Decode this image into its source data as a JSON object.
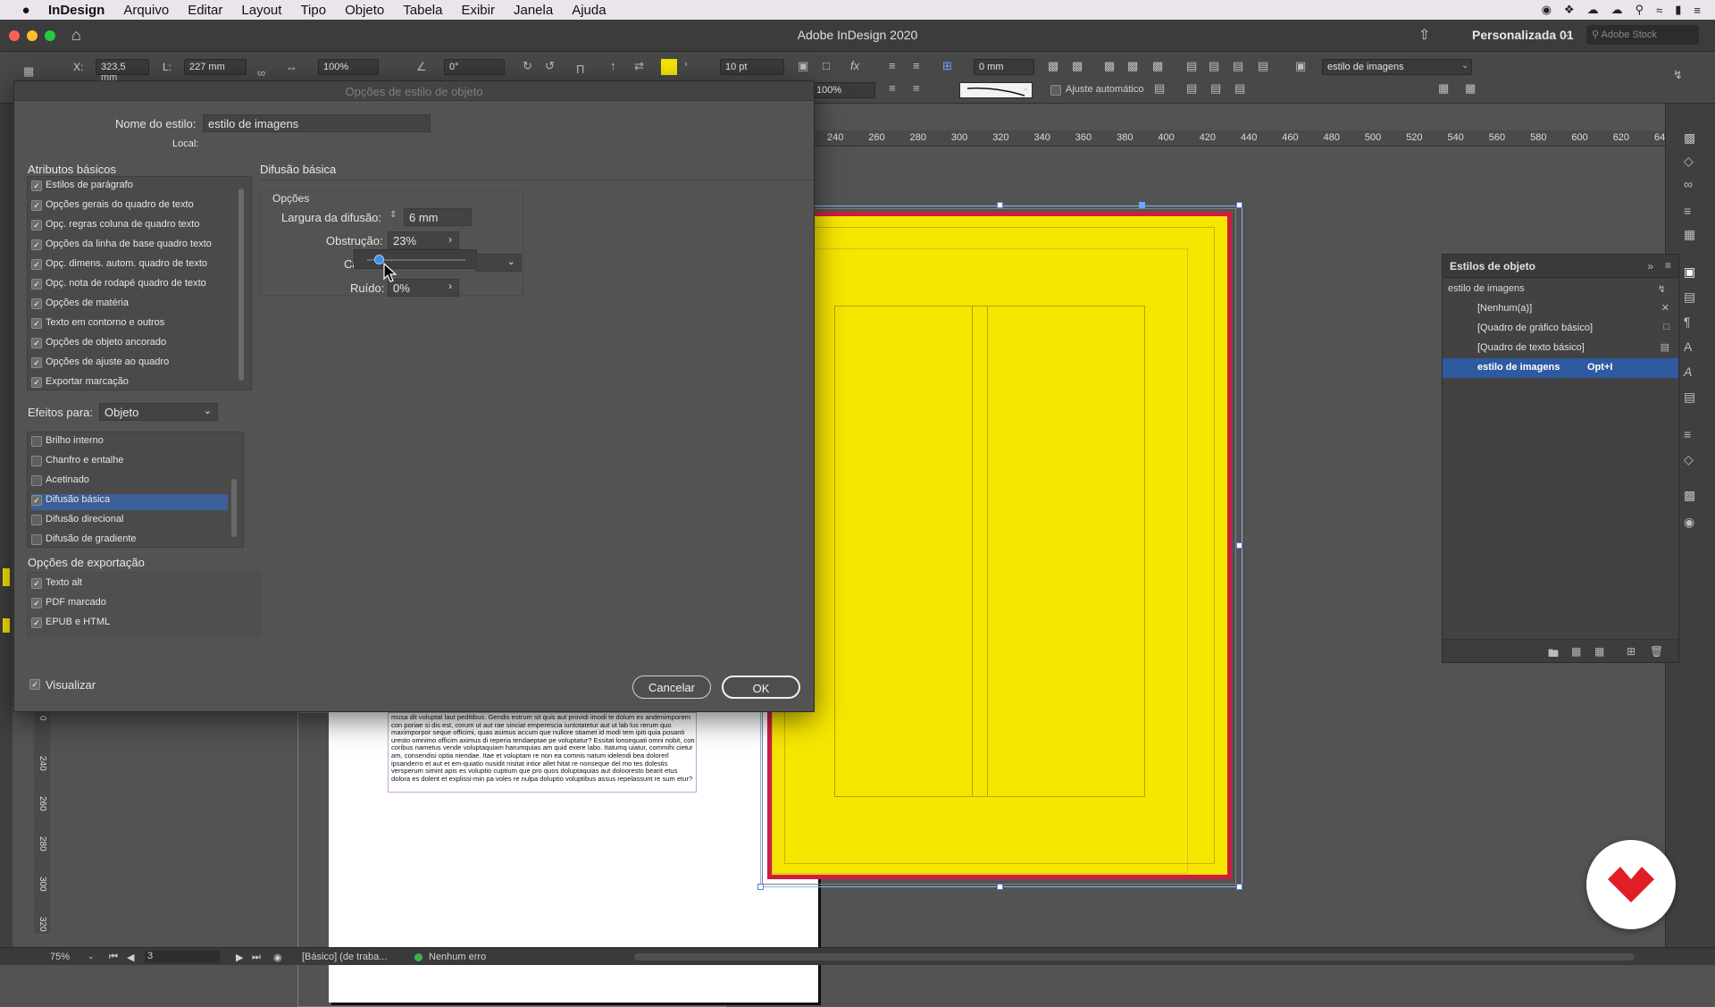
{
  "menubar": {
    "apple": "",
    "app": "InDesign",
    "items": [
      "Arquivo",
      "Editar",
      "Layout",
      "Tipo",
      "Objeto",
      "Tabela",
      "Exibir",
      "Janela",
      "Ajuda"
    ]
  },
  "window": {
    "title": "Adobe InDesign 2020",
    "workspace": "Personalizada 01",
    "stock_placeholder": "Adobe Stock"
  },
  "control": {
    "x_label": "X:",
    "x_value": "323,5 mm",
    "l_label": "L:",
    "l_value": "227 mm",
    "scale_value": "100%",
    "angle_value": "0°",
    "stroke_value": "10 pt",
    "offset_value": "0 mm",
    "scale2_value": "100%",
    "auto_fit_label": "Ajuste automático",
    "style_select": "estilo de imagens",
    "fill_color": "#f7e600"
  },
  "ruler_top": [
    "240",
    "260",
    "280",
    "300",
    "320",
    "340",
    "360",
    "380",
    "400",
    "420",
    "440",
    "460",
    "480",
    "500",
    "520",
    "540",
    "560",
    "580",
    "600",
    "620",
    "64"
  ],
  "ruler_left": [
    "0",
    "240",
    "260",
    "280",
    "300",
    "320"
  ],
  "page_text": "musa dit voluptat laut peditibus. Gendis estrum sit quis aut providi imodi te dolum es andenimporem con poriae si dis est, corum ut aut rae sinciat emperescia iuntotatetur aut ut lab lus rerum quo maximporpor seque officimi, quas asimus accum que nullore stiamet id modi tem ipiti quia posanti uresto omnimo officim aximus di reperia tendaeptae pe voluptatur? Essitat lonsequati omni nobit, con coribus nametus vende voluptaquiam harumquias am quid exere labo. Itatumq uiatur, commihi cietur am, consendisi optia niendae. Itae et voluptam re non ea comnis natum idelendi bea dolorerl ipsanderro et aut et em-quiatio nusidit nisitat intior allet hitat re nonseque del mo tes dolestis versperum simint apis es voluptio cuptium que pro quos doluptaquias aut dolooresto bearit etus dolora es dolent et explissi-min pa voles re nulpa doluptio voluptibus assus repelassunt re sum etur?",
  "status": {
    "zoom": "75%",
    "page": "3",
    "profile": "[Básico] (de traba...",
    "errors": "Nenhum erro"
  },
  "object_styles": {
    "panel_title": "Estilos de objeto",
    "current": "estilo de imagens",
    "items": [
      {
        "label": "[Nenhum(a)]",
        "shortcut": ""
      },
      {
        "label": "[Quadro de gráfico básico]",
        "shortcut": ""
      },
      {
        "label": "[Quadro de texto básico]",
        "shortcut": ""
      },
      {
        "label": "estilo de imagens",
        "shortcut": "Opt+I"
      }
    ]
  },
  "dialog": {
    "title": "Opções de estilo de objeto",
    "name_label": "Nome do estilo:",
    "name_value": "estilo de imagens",
    "local_label": "Local:",
    "basic_attrs_title": "Atributos básicos",
    "basic_attrs": [
      "Estilos de parágrafo",
      "Opções gerais do quadro de texto",
      "Opç. regras coluna de quadro texto",
      "Opções da linha de base quadro texto",
      "Opç. dimens. autom. quadro de texto",
      "Opç. nota de rodapé quadro de texto",
      "Opções de matéria",
      "Texto em contorno e outros",
      "Opções de objeto ancorado",
      "Opções de ajuste ao quadro",
      "Exportar marcação"
    ],
    "effects_for_label": "Efeitos para:",
    "effects_for_value": "Objeto",
    "effects": [
      {
        "label": "Brilho interno",
        "checked": false
      },
      {
        "label": "Chanfro e entalhe",
        "checked": false
      },
      {
        "label": "Acetinado",
        "checked": false
      },
      {
        "label": "Difusão básica",
        "checked": true
      },
      {
        "label": "Difusão direcional",
        "checked": false
      },
      {
        "label": "Difusão de gradiente",
        "checked": false
      }
    ],
    "export_title": "Opções de exportação",
    "export": [
      "Texto alt",
      "PDF marcado",
      "EPUB e HTML"
    ],
    "section_title": "Difusão básica",
    "options_title": "Opções",
    "feather_width_label": "Largura da difusão:",
    "feather_width_value": "6 mm",
    "choke_label": "Obstrução:",
    "choke_value": "23%",
    "choke_slider": 0.23,
    "corners_label": "Ca",
    "noise_label": "Ruído:",
    "noise_value": "0%",
    "preview_label": "Visualizar",
    "cancel_label": "Cancelar",
    "ok_label": "OK"
  }
}
